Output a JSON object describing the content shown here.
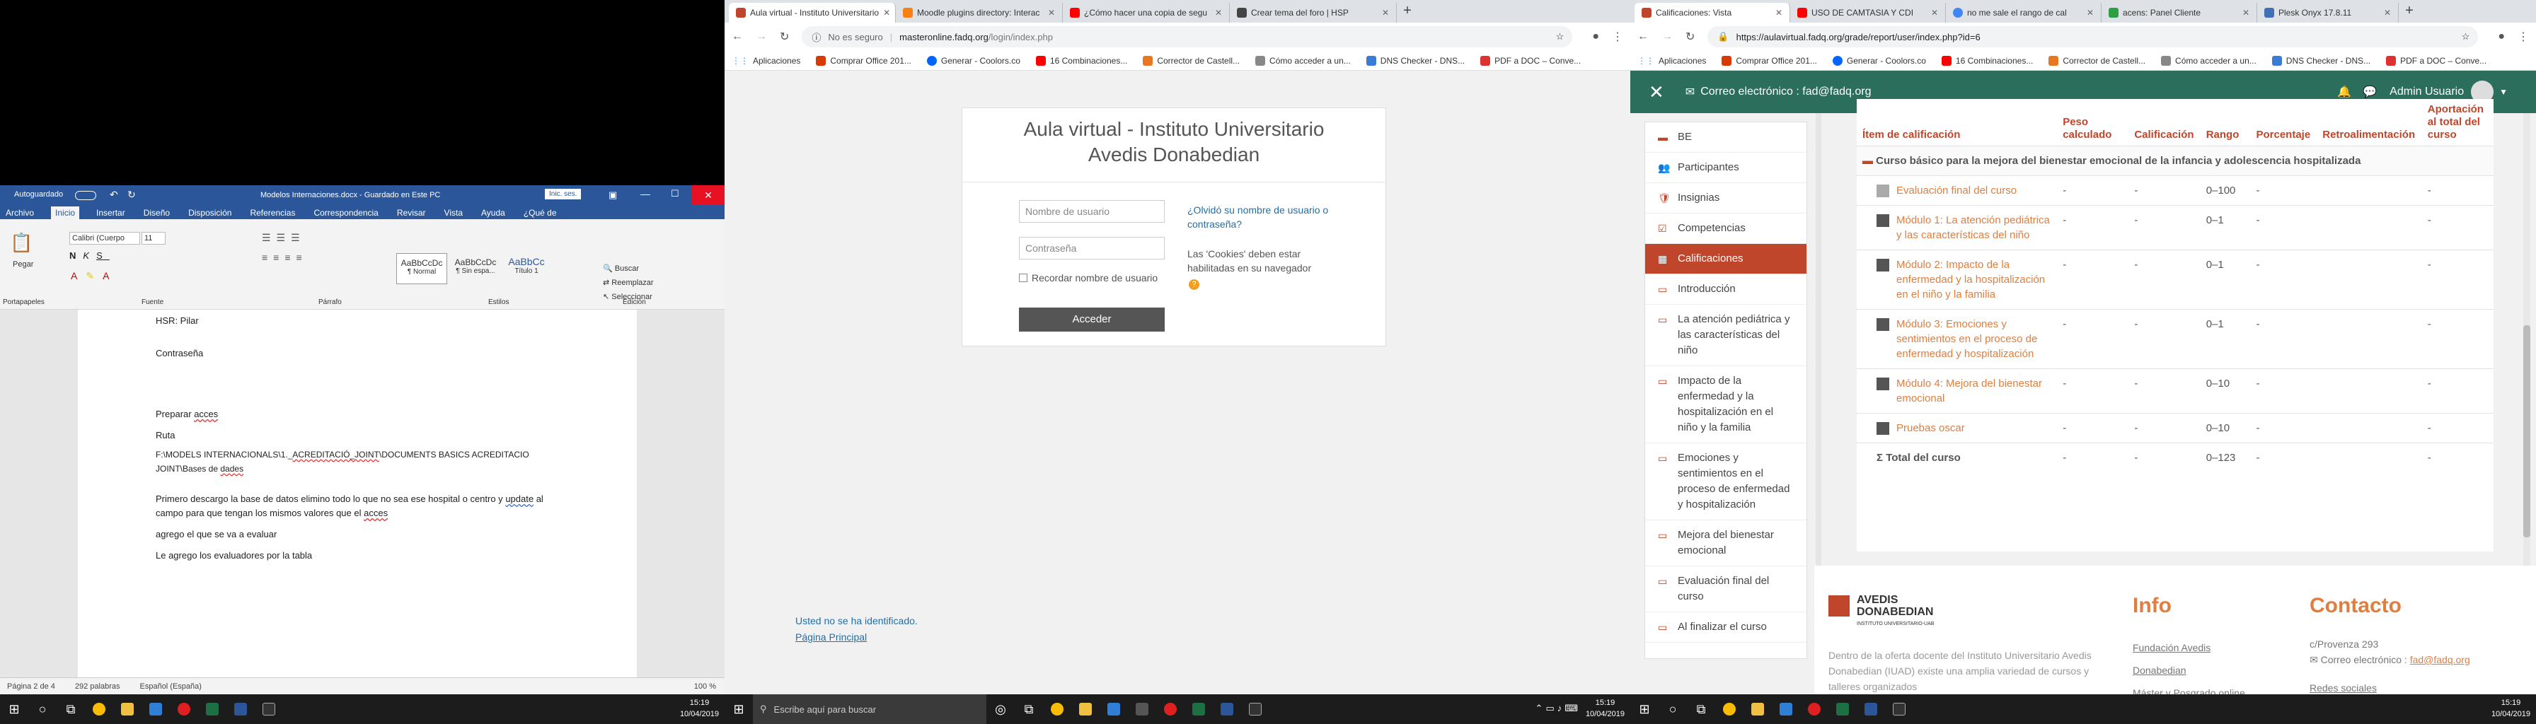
{
  "word": {
    "autosave_label": "Autoguardado",
    "doc_title": "Modelos Internaciones.docx - Guardado en Este PC",
    "signin_label": "Inic. ses.",
    "menu": [
      "Archivo",
      "Inicio",
      "Insertar",
      "Diseño",
      "Disposición",
      "Referencias",
      "Correspondencia",
      "Revisar",
      "Vista",
      "Ayuda",
      "¿Qué de"
    ],
    "paste_label": "Pegar",
    "font_name": "Calibri (Cuerpo",
    "font_size": "11",
    "styles": [
      {
        "preview": "AaBbCcDc",
        "name": "¶ Normal"
      },
      {
        "preview": "AaBbCcDc",
        "name": "¶ Sin espa..."
      },
      {
        "preview": "AaBbCc",
        "name": "Título 1"
      }
    ],
    "edit_items": [
      "Buscar",
      "Reemplazar",
      "Seleccionar"
    ],
    "groups": [
      "Portapapeles",
      "Fuente",
      "Párrafo",
      "Estilos",
      "Edición"
    ],
    "lines": {
      "hsr": "HSR: Pilar",
      "password": "Contraseña",
      "prepare_pre": "Preparar ",
      "prepare_word": "acces",
      "route": "Ruta",
      "path_a": "F:\\MODELS INTERNACIONALS\\1._",
      "path_b": "ACREDITACIÓ_JOINT",
      "path_c": "\\DOCUMENTS BASICS ACREDITACIO",
      "path2_a": "JOINT\\Bases de ",
      "path2_b": "dades",
      "first_a": "Primero descargo la base de datos elimino todo lo que no sea ese hospital o centro y ",
      "first_b": "update",
      "first_c": " al",
      "second_a": "campo para que tengan los mismos valores que el ",
      "second_b": "acces",
      "third": "agrego el que se va a evaluar",
      "fourth": "Le agrego los evaluadores por la tabla"
    },
    "status": {
      "page": "Página 2 de 4",
      "words": "292 palabras",
      "lang": "Español (España)",
      "zoom": "100 %"
    }
  },
  "taskbar_left": {
    "time": "15:19",
    "date": "10/04/2019"
  },
  "taskbar_mid": {
    "search_placeholder": "Escribe aquí para buscar",
    "time": "15:19",
    "date": "10/04/2019"
  },
  "taskbar_right": {
    "time": "15:19",
    "date": "10/04/2019"
  },
  "browser_left": {
    "tabs": [
      {
        "title": "Aula virtual - Instituto Universitario",
        "color": "#c0462b"
      },
      {
        "title": "Moodle plugins directory: Interac",
        "color": "#f98012"
      },
      {
        "title": "¿Cómo hacer una copia de segu",
        "color": "#ff0000"
      },
      {
        "title": "Crear tema del foro | HSP",
        "color": "#444444"
      }
    ],
    "not_secure": "No es seguro",
    "url_domain": "masteronline.fadq.org",
    "url_path": "/login/index.php",
    "bookmarks": [
      "Aplicaciones",
      "Comprar Office 201...",
      "Generar - Coolors.co",
      "16 Combinaciones...",
      "Corrector de Castell...",
      "Cómo acceder a un...",
      "DNS Checker - DNS...",
      "PDF a DOC – Conve..."
    ],
    "login": {
      "title": "Aula virtual - Instituto Universitario Avedis Donabedian",
      "username_placeholder": "Nombre de usuario",
      "password_placeholder": "Contraseña",
      "remember": "Recordar nombre de usuario",
      "submit": "Acceder",
      "forgot": "¿Olvidó su nombre de usuario o contraseña?",
      "cookies": "Las 'Cookies' deben estar habilitadas en su navegador"
    },
    "not_identified": "Usted no se ha identificado.",
    "main_page": "Página Principal"
  },
  "browser_right": {
    "tabs": [
      {
        "title": "Calificaciones: Vista",
        "color": "#c0462b"
      },
      {
        "title": "USO DE CAMTASIA Y CDI",
        "color": "#ff0000"
      },
      {
        "title": "no me sale el rango de cal",
        "color": "#4285f4"
      },
      {
        "title": "acens: Panel Cliente",
        "color": "#2ea043"
      },
      {
        "title": "Plesk Onyx 17.8.11",
        "color": "#3f6fb5"
      }
    ],
    "url": "https://aulavirtual.fadq.org/grade/report/user/index.php?id=6",
    "bookmarks": [
      "Aplicaciones",
      "Comprar Office 201...",
      "Generar - Coolors.co",
      "16 Combinaciones...",
      "Corrector de Castell...",
      "Cómo acceder a un...",
      "DNS Checker - DNS...",
      "PDF a DOC – Conve..."
    ],
    "topbar": {
      "email": "Correo electrónico : fad@fadq.org",
      "user": "Admin Usuario"
    },
    "sidebar": [
      {
        "label": "BE",
        "icon": "▬"
      },
      {
        "label": "Participantes",
        "icon": "👥"
      },
      {
        "label": "Insignias",
        "icon": "🛡"
      },
      {
        "label": "Competencias",
        "icon": "☑"
      },
      {
        "label": "Calificaciones",
        "icon": "▦"
      },
      {
        "label": "Introducción",
        "icon": "▭"
      },
      {
        "label": "La atención pediátrica y las características del niño",
        "icon": "▭"
      },
      {
        "label": "Impacto de la enfermedad y la hospitalización en el niño y la familia",
        "icon": "▭"
      },
      {
        "label": "Emociones y sentimientos en el proceso de enfermedad y hospitalización",
        "icon": "▭"
      },
      {
        "label": "Mejora del bienestar emocional",
        "icon": "▭"
      },
      {
        "label": "Evaluación final del curso",
        "icon": "▭"
      },
      {
        "label": "Al finalizar el curso",
        "icon": "▭"
      }
    ],
    "grades": {
      "headers": [
        "Ítem de calificación",
        "Peso calculado",
        "Calificación",
        "Rango",
        "Porcentaje",
        "Retroalimentación",
        "Aportación al total del curso"
      ],
      "course": "Curso básico para la mejora del bienestar emocional de la infancia y adolescencia hospitalizada",
      "rows": [
        {
          "name": "Evaluación final del curso",
          "peso": "-",
          "cal": "-",
          "rango": "0–100",
          "pct": "-",
          "retro": "",
          "aport": "-"
        },
        {
          "name": "Módulo 1: La atención pediátrica y las características del niño",
          "peso": "-",
          "cal": "-",
          "rango": "0–1",
          "pct": "-",
          "retro": "",
          "aport": "-"
        },
        {
          "name": "Módulo 2: Impacto de la enfermedad y la hospitalización en el niño y la familia",
          "peso": "-",
          "cal": "-",
          "rango": "0–1",
          "pct": "-",
          "retro": "",
          "aport": "-"
        },
        {
          "name": "Módulo 3: Emociones y sentimientos en el proceso de enfermedad y hospitalización",
          "peso": "-",
          "cal": "-",
          "rango": "0–1",
          "pct": "-",
          "retro": "",
          "aport": "-"
        },
        {
          "name": "Módulo 4: Mejora del bienestar emocional",
          "peso": "-",
          "cal": "-",
          "rango": "0–10",
          "pct": "-",
          "retro": "",
          "aport": "-"
        },
        {
          "name": "Pruebas oscar",
          "peso": "-",
          "cal": "-",
          "rango": "0–10",
          "pct": "-",
          "retro": "",
          "aport": "-"
        }
      ],
      "total": {
        "name": "Total del curso",
        "peso": "-",
        "cal": "-",
        "rango": "0–123",
        "pct": "-",
        "retro": "",
        "aport": "-"
      }
    },
    "footer": {
      "logo_line1": "AVEDIS",
      "logo_line2": "DONABEDIAN",
      "logo_line3": "INSTITUTO UNIVERSITARIO-UAB",
      "about": "Dentro de la oferta docente del Instituto Universitario Avedis Donabedian (IUAD) existe una amplia variedad de cursos y talleres organizados",
      "info_title": "Info",
      "info_links": [
        "Fundación Avedis",
        "Donabedian",
        "Máster y Posgrado online"
      ],
      "contact_title": "Contacto",
      "contact_addr": "c/Provenza 293",
      "contact_email_label": "Correo electrónico :",
      "contact_email": "fad@fadq.org",
      "social": "Redes sociales"
    }
  },
  "colors": {
    "moodle_green": "#2c6e5c",
    "moodle_orange": "#c0462b",
    "link_orange": "#e07e40",
    "word_blue": "#2b579a"
  }
}
